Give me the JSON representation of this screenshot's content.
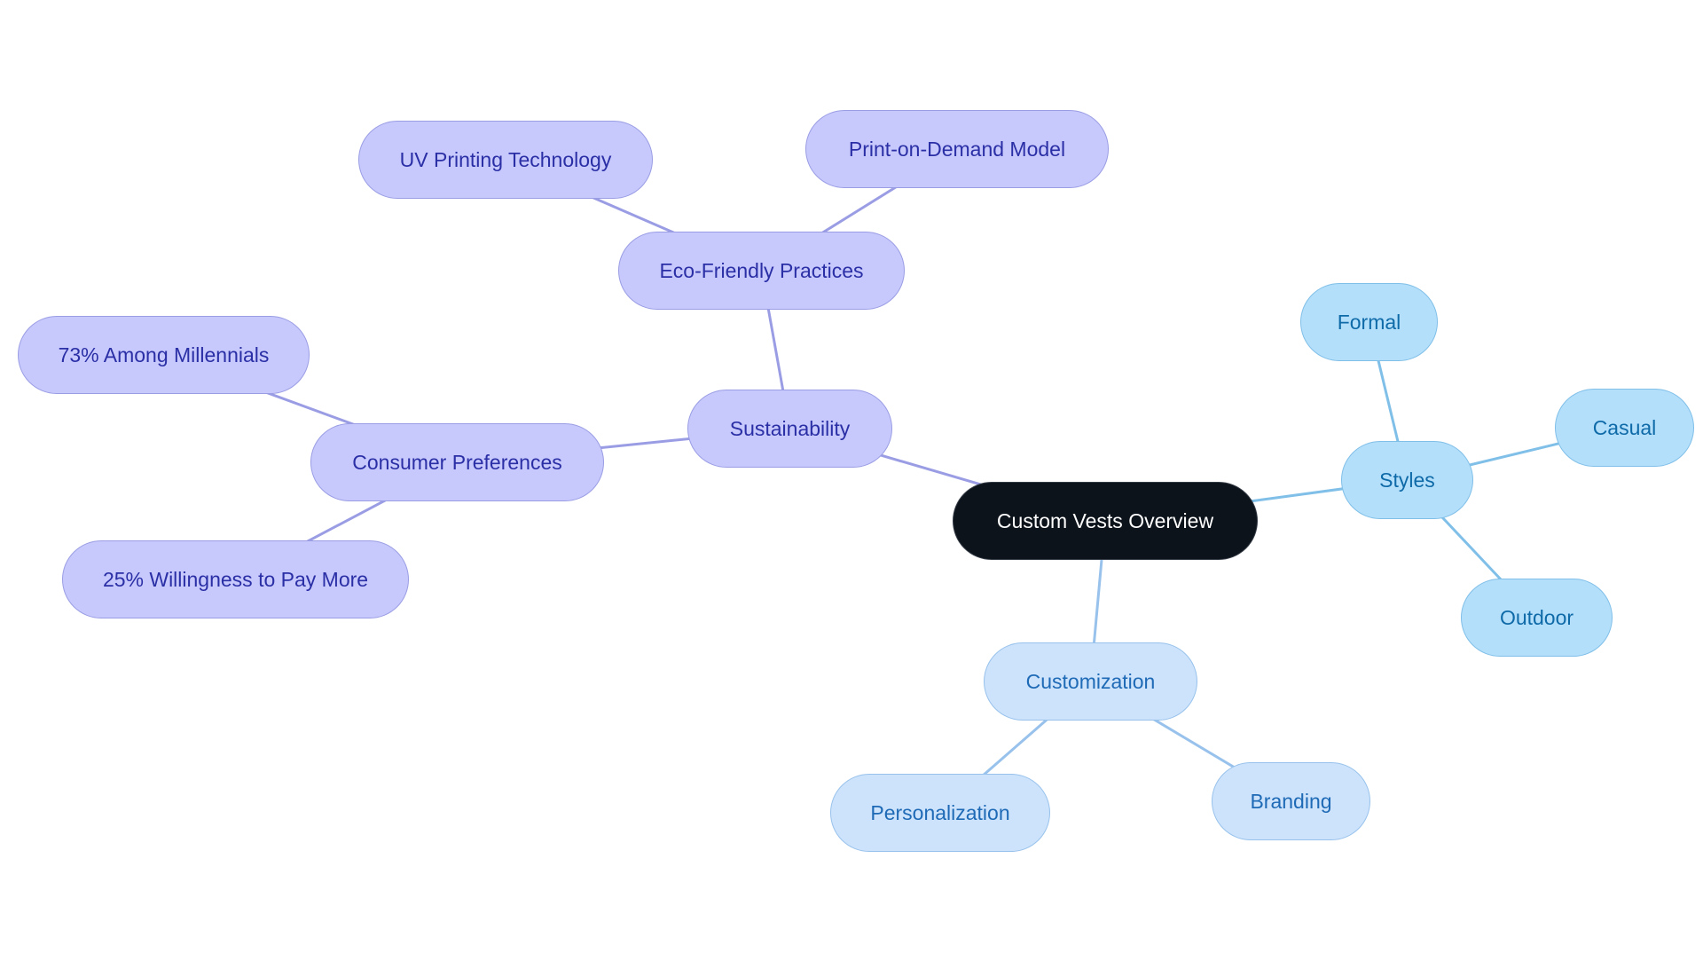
{
  "diagram": {
    "title": "Custom Vests Overview",
    "colors": {
      "root_fill": "#0d131b",
      "root_text": "#ffffff",
      "purple_fill": "#c7c9fc",
      "purple_text": "#2b2fa6",
      "purple_edge": "#9a9de4",
      "sky_fill": "#b3dffb",
      "sky_text": "#0f6aa8",
      "sky_edge": "#80bfe8",
      "lightblue_fill": "#cde3fb",
      "lightblue_text": "#1e6ab6",
      "lightblue_edge": "#98c2ec"
    },
    "nodes": [
      {
        "id": "root",
        "label": "Custom Vests Overview",
        "theme": "root"
      },
      {
        "id": "sustainability",
        "label": "Sustainability",
        "theme": "purple",
        "parent": "root"
      },
      {
        "id": "eco",
        "label": "Eco-Friendly Practices",
        "theme": "purple",
        "parent": "sustainability"
      },
      {
        "id": "uv",
        "label": "UV Printing Technology",
        "theme": "purple",
        "parent": "eco"
      },
      {
        "id": "pod",
        "label": "Print-on-Demand Model",
        "theme": "purple",
        "parent": "eco"
      },
      {
        "id": "consumer",
        "label": "Consumer Preferences",
        "theme": "purple",
        "parent": "sustainability"
      },
      {
        "id": "millennials",
        "label": "73% Among Millennials",
        "theme": "purple",
        "parent": "consumer"
      },
      {
        "id": "willingness",
        "label": "25% Willingness to Pay More",
        "theme": "purple",
        "parent": "consumer"
      },
      {
        "id": "styles",
        "label": "Styles",
        "theme": "sky",
        "parent": "root"
      },
      {
        "id": "formal",
        "label": "Formal",
        "theme": "sky",
        "parent": "styles"
      },
      {
        "id": "casual",
        "label": "Casual",
        "theme": "sky",
        "parent": "styles"
      },
      {
        "id": "outdoor",
        "label": "Outdoor",
        "theme": "sky",
        "parent": "styles"
      },
      {
        "id": "customization",
        "label": "Customization",
        "theme": "lightblue",
        "parent": "root"
      },
      {
        "id": "personalization",
        "label": "Personalization",
        "theme": "lightblue",
        "parent": "customization"
      },
      {
        "id": "branding",
        "label": "Branding",
        "theme": "lightblue",
        "parent": "customization"
      }
    ]
  }
}
